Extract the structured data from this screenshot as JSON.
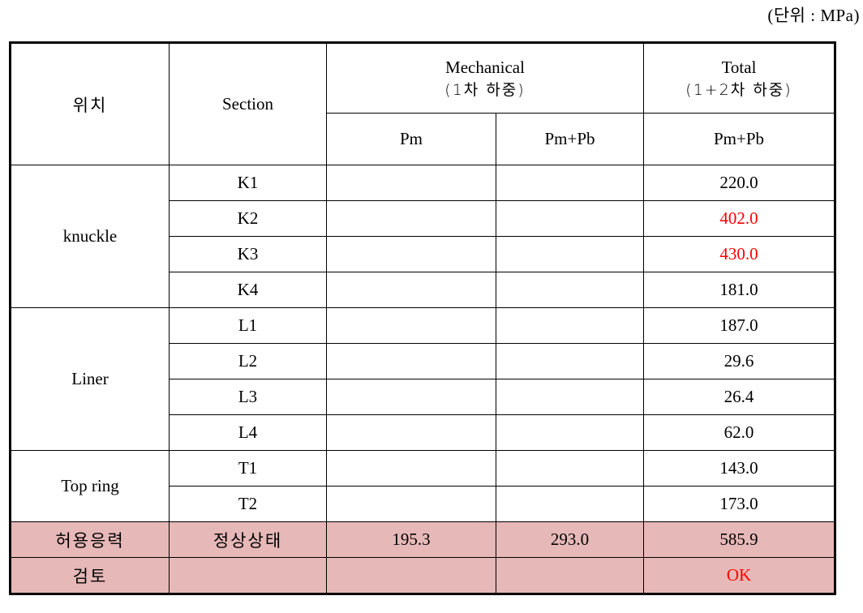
{
  "unit_label": "(단위 : MPa)",
  "header": {
    "position": "위치",
    "section": "Section",
    "mechanical_title": "Mechanical",
    "mechanical_sub": "(1차 하중)",
    "total_title": "Total",
    "total_sub": "(1+2차 하중)",
    "pm": "Pm",
    "pm_pb": "Pm+Pb",
    "total_pm_pb": "Pm+Pb"
  },
  "groups": [
    {
      "name": "knuckle",
      "rows": [
        {
          "section": "K1",
          "pm": "",
          "pm_pb": "",
          "total": "220.0",
          "exceed": false
        },
        {
          "section": "K2",
          "pm": "",
          "pm_pb": "",
          "total": "402.0",
          "exceed": true
        },
        {
          "section": "K3",
          "pm": "",
          "pm_pb": "",
          "total": "430.0",
          "exceed": true
        },
        {
          "section": "K4",
          "pm": "",
          "pm_pb": "",
          "total": "181.0",
          "exceed": false
        }
      ]
    },
    {
      "name": "Liner",
      "rows": [
        {
          "section": "L1",
          "pm": "",
          "pm_pb": "",
          "total": "187.0",
          "exceed": false
        },
        {
          "section": "L2",
          "pm": "",
          "pm_pb": "",
          "total": "29.6",
          "exceed": false
        },
        {
          "section": "L3",
          "pm": "",
          "pm_pb": "",
          "total": "26.4",
          "exceed": false
        },
        {
          "section": "L4",
          "pm": "",
          "pm_pb": "",
          "total": "62.0",
          "exceed": false
        }
      ]
    },
    {
      "name": "Top ring",
      "rows": [
        {
          "section": "T1",
          "pm": "",
          "pm_pb": "",
          "total": "143.0",
          "exceed": false
        },
        {
          "section": "T2",
          "pm": "",
          "pm_pb": "",
          "total": "173.0",
          "exceed": false
        }
      ]
    }
  ],
  "allowable": {
    "label": "허용응력",
    "condition": "정상상태",
    "pm": "195.3",
    "pm_pb": "293.0",
    "total": "585.9"
  },
  "review": {
    "label": "검토",
    "condition": "",
    "pm": "",
    "pm_pb": "",
    "total": "OK"
  },
  "colors": {
    "highlight_row": "#e6b8b7",
    "exceed_text": "#ff0000"
  }
}
